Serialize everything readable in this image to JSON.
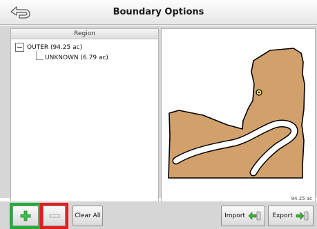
{
  "header": {
    "title": "Boundary Options",
    "back_icon": "back-arrow-icon"
  },
  "region_list": {
    "column_header": "Region",
    "items": [
      {
        "label": "OUTER (94.25 ac)",
        "expanded": true
      },
      {
        "label": "UNKNOWN (6.79 ac)"
      }
    ]
  },
  "map": {
    "area_label": "94.25 ac",
    "field_color": "#d2a06a",
    "outline_color": "#000000"
  },
  "toolbar": {
    "add_icon": "plus-icon",
    "remove_icon": "minus-icon",
    "clear_all_label": "Clear All",
    "import_label": "Import",
    "export_label": "Export",
    "add_highlight_color": "#1fae36",
    "remove_highlight_color": "#e01e1e"
  }
}
